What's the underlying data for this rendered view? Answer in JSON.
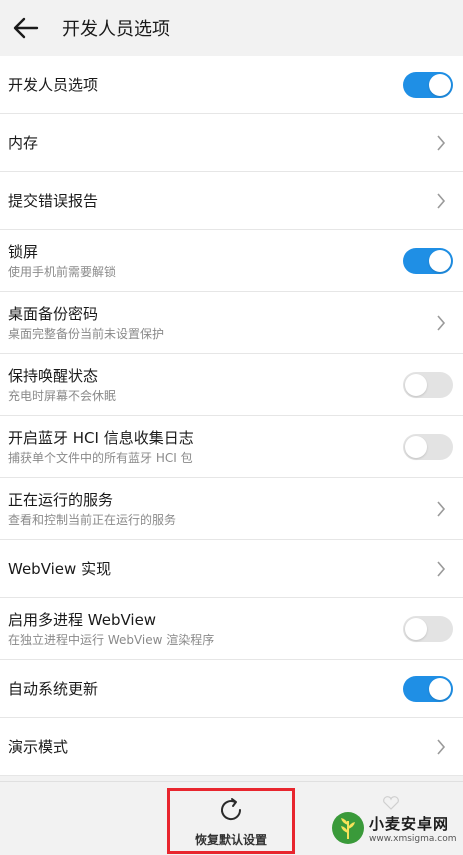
{
  "header": {
    "title": "开发人员选项"
  },
  "rows": [
    {
      "label": "开发人员选项",
      "sub": "",
      "control": "switch",
      "state": "on"
    },
    {
      "label": "内存",
      "sub": "",
      "control": "chevron"
    },
    {
      "label": "提交错误报告",
      "sub": "",
      "control": "chevron"
    },
    {
      "label": "锁屏",
      "sub": "使用手机前需要解锁",
      "control": "switch",
      "state": "on"
    },
    {
      "label": "桌面备份密码",
      "sub": "桌面完整备份当前未设置保护",
      "control": "chevron"
    },
    {
      "label": "保持唤醒状态",
      "sub": "充电时屏幕不会休眠",
      "control": "switch",
      "state": "off"
    },
    {
      "label": "开启蓝牙 HCI 信息收集日志",
      "sub": "捕获单个文件中的所有蓝牙 HCI 包",
      "control": "switch",
      "state": "off"
    },
    {
      "label": "正在运行的服务",
      "sub": "查看和控制当前正在运行的服务",
      "control": "chevron"
    },
    {
      "label": "WebView 实现",
      "sub": "",
      "control": "chevron"
    },
    {
      "label": "启用多进程 WebView",
      "sub": "在独立进程中运行 WebView 渲染程序",
      "control": "switch",
      "state": "off"
    },
    {
      "label": "自动系统更新",
      "sub": "",
      "control": "switch",
      "state": "on"
    },
    {
      "label": "演示模式",
      "sub": "",
      "control": "chevron"
    }
  ],
  "bottom": {
    "reset_label": "恢复默认设置"
  },
  "watermark": {
    "title": "小麦安卓网",
    "url": "www.xmsigma.com"
  },
  "colors": {
    "switch_on": "#1f8fe5",
    "switch_off": "#e3e3e3",
    "highlight_border": "#e8262e"
  }
}
